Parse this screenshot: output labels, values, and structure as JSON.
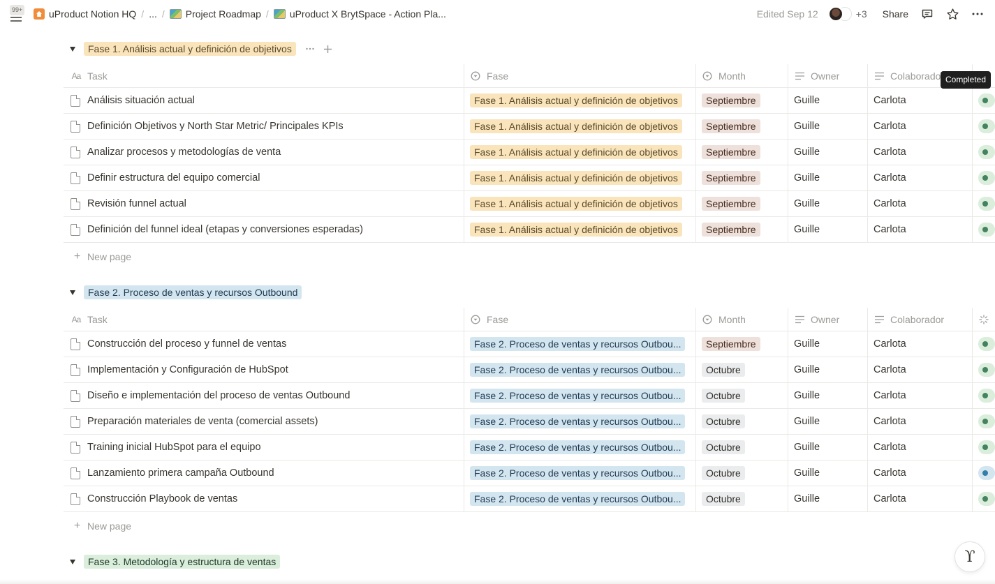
{
  "topbar": {
    "notifications": "99+",
    "breadcrumbs": [
      {
        "label": "uProduct Notion HQ",
        "icon": "home-icon"
      },
      {
        "label": "...",
        "icon": ""
      },
      {
        "label": "Project Roadmap",
        "icon": "map-icon"
      },
      {
        "label": "uProduct X BrytSpace - Action Pla...",
        "icon": "map-icon"
      }
    ],
    "edited": "Edited Sep 12",
    "extra_collaborators": "+3",
    "share_label": "Share"
  },
  "columns": {
    "task": "Task",
    "fase": "Fase",
    "month": "Month",
    "owner": "Owner",
    "colaborador": "Colaborador",
    "colaborador_truncated": "Colaborado"
  },
  "tooltip": "Completed",
  "new_page_label": "New page",
  "groups": [
    {
      "title": "Fase 1. Análisis actual y definición de objetivos",
      "color": "#f9e4bc",
      "rows": [
        {
          "task": "Análisis situación actual",
          "fase": "Fase 1. Análisis actual y definición de objetivos",
          "month": "Septiembre",
          "owner": "Guille",
          "colaborador": "Carlota",
          "status": "completed"
        },
        {
          "task": "Definición Objetivos y North Star Metric/ Principales KPIs",
          "fase": "Fase 1. Análisis actual y definición de objetivos",
          "month": "Septiembre",
          "owner": "Guille",
          "colaborador": "Carlota",
          "status": "completed"
        },
        {
          "task": "Analizar procesos y metodologías de venta",
          "fase": "Fase 1. Análisis actual y definición de objetivos",
          "month": "Septiembre",
          "owner": "Guille",
          "colaborador": "Carlota",
          "status": "completed"
        },
        {
          "task": "Definir estructura del equipo comercial",
          "fase": "Fase 1. Análisis actual y definición de objetivos",
          "month": "Septiembre",
          "owner": "Guille",
          "colaborador": "Carlota",
          "status": "completed"
        },
        {
          "task": "Revisión funnel actual",
          "fase": "Fase 1. Análisis actual y definición de objetivos",
          "month": "Septiembre",
          "owner": "Guille",
          "colaborador": "Carlota",
          "status": "completed"
        },
        {
          "task": "Definición del funnel ideal (etapas y conversiones esperadas)",
          "fase": "Fase 1. Análisis actual y definición de objetivos",
          "month": "Septiembre",
          "owner": "Guille",
          "colaborador": "Carlota",
          "status": "completed"
        }
      ]
    },
    {
      "title": "Fase 2. Proceso de ventas y recursos Outbound",
      "color": "#d3e5ef",
      "rows": [
        {
          "task": "Construcción del proceso y funnel de ventas",
          "fase": "Fase 2. Proceso de ventas y recursos Outbou...",
          "month": "Septiembre",
          "owner": "Guille",
          "colaborador": "Carlota",
          "status": "completed"
        },
        {
          "task": "Implementación y Configuración de HubSpot",
          "fase": "Fase 2. Proceso de ventas y recursos Outbou...",
          "month": "Octubre",
          "owner": "Guille",
          "colaborador": "Carlota",
          "status": "completed"
        },
        {
          "task": "Diseño e implementación del proceso de ventas Outbound",
          "fase": "Fase 2. Proceso de ventas y recursos Outbou...",
          "month": "Octubre",
          "owner": "Guille",
          "colaborador": "Carlota",
          "status": "completed"
        },
        {
          "task": "Preparación materiales de venta (comercial assets)",
          "fase": "Fase 2. Proceso de ventas y recursos Outbou...",
          "month": "Octubre",
          "owner": "Guille",
          "colaborador": "Carlota",
          "status": "completed"
        },
        {
          "task": "Training inicial HubSpot para el equipo",
          "fase": "Fase 2. Proceso de ventas y recursos Outbou...",
          "month": "Octubre",
          "owner": "Guille",
          "colaborador": "Carlota",
          "status": "completed"
        },
        {
          "task": "Lanzamiento primera campaña Outbound",
          "fase": "Fase 2. Proceso de ventas y recursos Outbou...",
          "month": "Octubre",
          "owner": "Guille",
          "colaborador": "Carlota",
          "status": "in-progress"
        },
        {
          "task": "Construcción Playbook de ventas",
          "fase": "Fase 2. Proceso de ventas y recursos Outbou...",
          "month": "Octubre",
          "owner": "Guille",
          "colaborador": "Carlota",
          "status": "completed"
        }
      ]
    },
    {
      "title": "Fase 3. Metodología y estructura de ventas",
      "color": "#dbeddb",
      "rows": []
    }
  ]
}
